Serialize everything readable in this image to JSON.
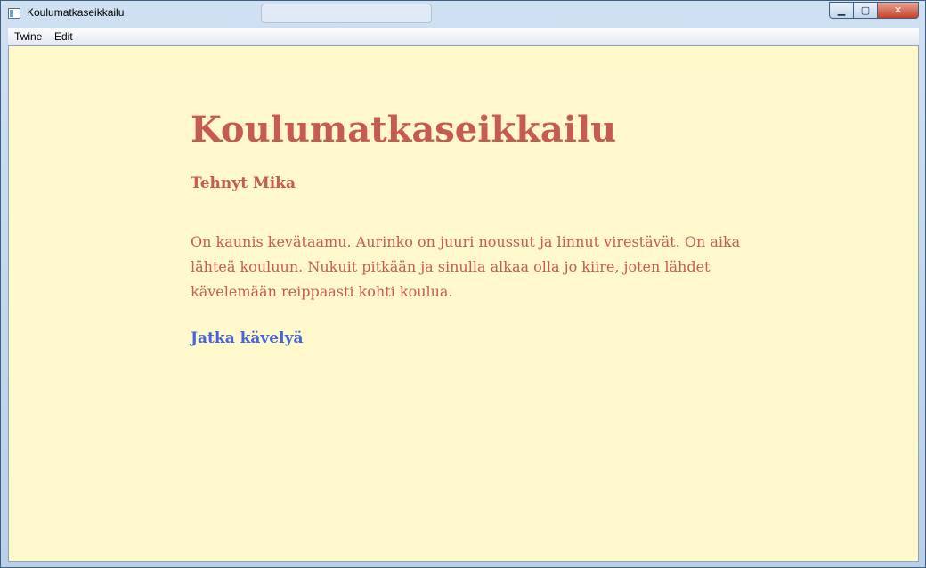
{
  "window": {
    "title": "Koulumatkaseikkailu",
    "controls": {
      "minimize": "▁",
      "maximize": "▢",
      "close": "✕"
    }
  },
  "menubar": {
    "items": [
      {
        "label": "Twine"
      },
      {
        "label": "Edit"
      }
    ]
  },
  "story": {
    "title": "Koulumatkaseikkailu",
    "author": "Tehnyt Mika",
    "passage": "On kaunis kevätaamu. Aurinko on juuri noussut ja linnut virestävät. On aika lähteä kouluun. Nukuit pitkään ja sinulla alkaa olla jo kiire, joten lähdet kävelemään reippaasti kohti koulua.",
    "link": "Jatka kävelyä"
  },
  "colors": {
    "background": "#fff8ca",
    "text": "#c65b53",
    "link": "#4666d8"
  },
  "icons": [
    "app-icon",
    "minimize-icon",
    "maximize-icon",
    "close-icon"
  ]
}
